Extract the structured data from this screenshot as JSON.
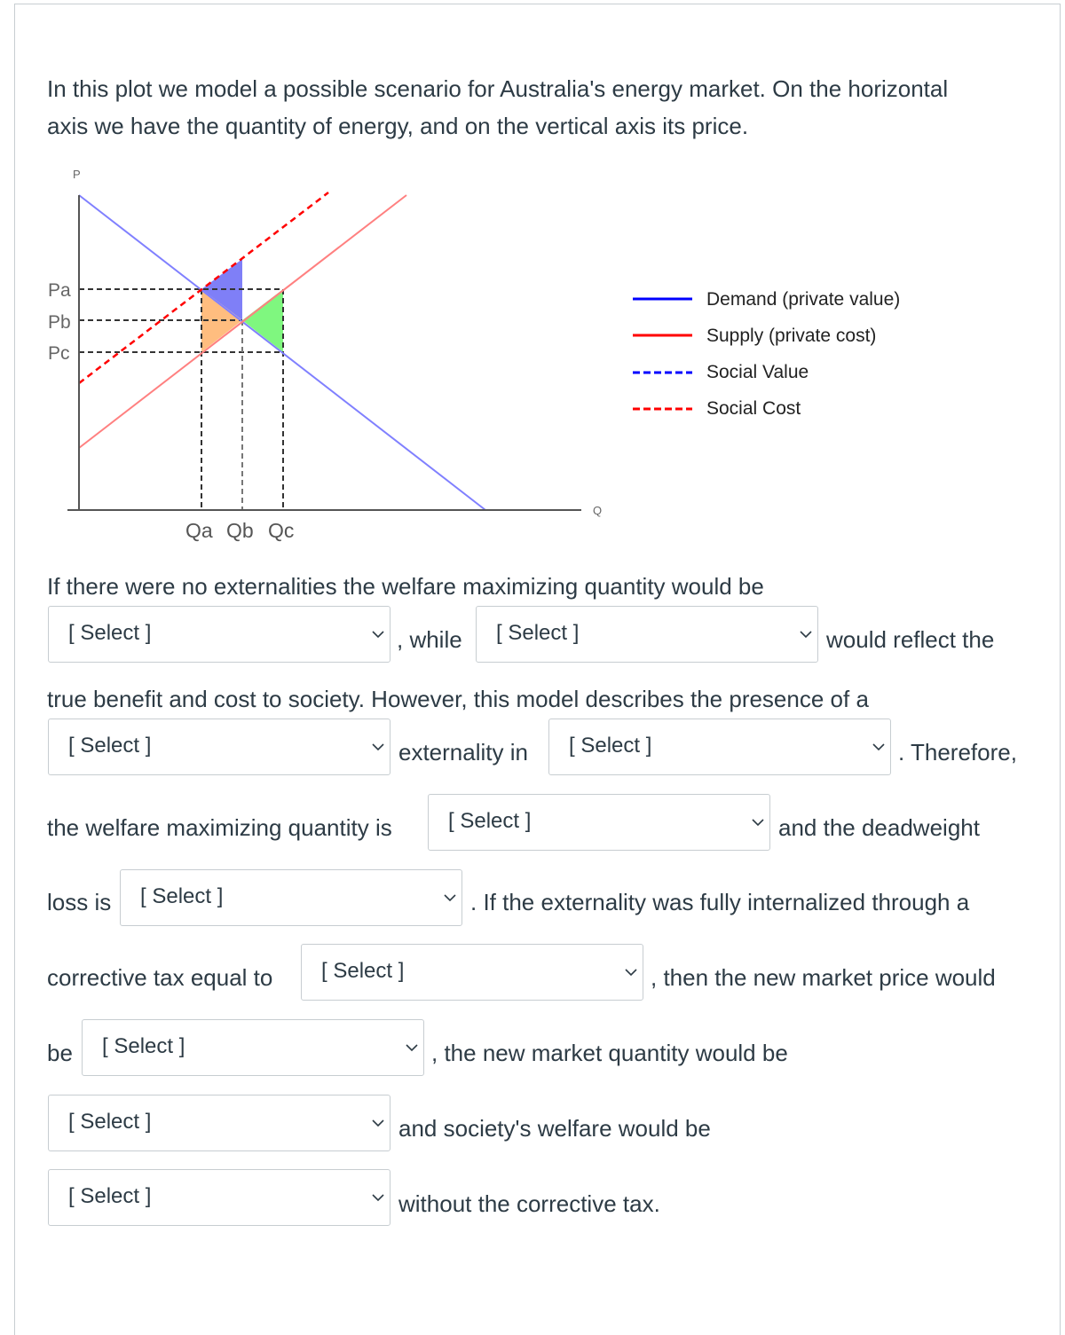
{
  "intro": [
    "In this plot we model a possible scenario for Australia's energy market. On the horizontal",
    "axis we have the quantity of energy, and on the vertical axis its price."
  ],
  "diagram": {
    "y_axis_label": "P",
    "x_axis_label": "Q",
    "price_labels": [
      "Pa",
      "Pb",
      "Pc"
    ],
    "quantity_labels": [
      "Qa",
      "Qb",
      "Qc"
    ],
    "legend": [
      {
        "label": "Demand (private value)",
        "color": "#0000ff",
        "style": "solid"
      },
      {
        "label": "Supply (private cost)",
        "color": "#ff0000",
        "style": "solid"
      },
      {
        "label": "Social Value",
        "color": "#0000ff",
        "style": "dashed"
      },
      {
        "label": "Social Cost",
        "color": "#ff0000",
        "style": "dashed"
      }
    ],
    "area_colors": {
      "blue": "#7f7ff7",
      "orange": "#ffbd7f",
      "green": "#7ff77f"
    }
  },
  "question": {
    "s1": "If there were no externalities the welfare maximizing quantity would be",
    "s2": ", while",
    "s3": "would reflect the",
    "s4": "true benefit and cost to society. However, this model describes the presence of a",
    "s5": "externality in",
    "s6": ". Therefore,",
    "s7": "the welfare maximizing quantity is",
    "s8": "and the deadweight",
    "s9": "loss is",
    "s10": ". If the externality was fully internalized through a",
    "s11": "corrective tax equal to",
    "s12": ", then the new market price would",
    "s13": "be",
    "s14": ", the new market quantity would be",
    "s15": "and society's welfare would be",
    "s16": "without the corrective tax."
  },
  "dropdowns": [
    "[ Select ]",
    "[ Select ]",
    "[ Select ]",
    "[ Select ]",
    "[ Select ]",
    "[ Select ]",
    "[ Select ]",
    "[ Select ]",
    "[ Select ]",
    "[ Select ]"
  ]
}
